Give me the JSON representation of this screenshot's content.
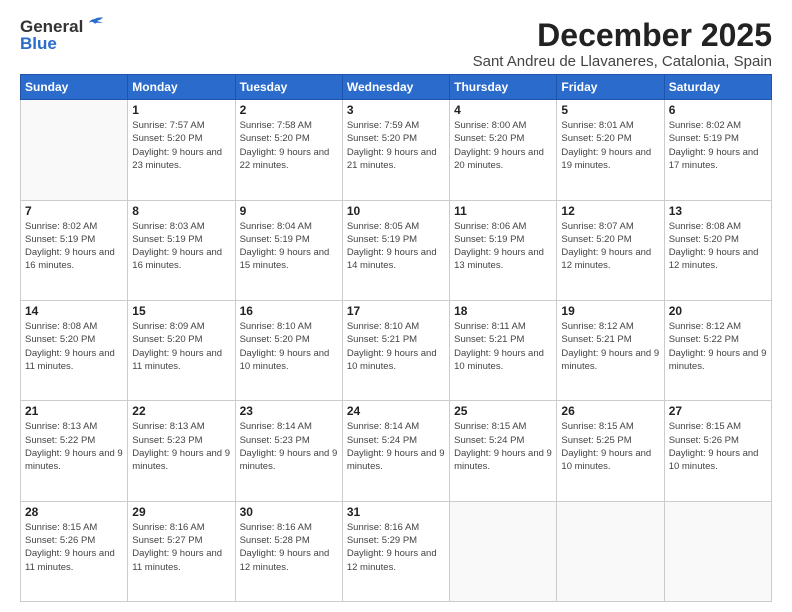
{
  "logo": {
    "general": "General",
    "blue": "Blue"
  },
  "title": "December 2025",
  "location": "Sant Andreu de Llavaneres, Catalonia, Spain",
  "weekdays": [
    "Sunday",
    "Monday",
    "Tuesday",
    "Wednesday",
    "Thursday",
    "Friday",
    "Saturday"
  ],
  "weeks": [
    [
      {
        "date": "",
        "sunrise": "",
        "sunset": "",
        "daylight": ""
      },
      {
        "date": "1",
        "sunrise": "Sunrise: 7:57 AM",
        "sunset": "Sunset: 5:20 PM",
        "daylight": "Daylight: 9 hours and 23 minutes."
      },
      {
        "date": "2",
        "sunrise": "Sunrise: 7:58 AM",
        "sunset": "Sunset: 5:20 PM",
        "daylight": "Daylight: 9 hours and 22 minutes."
      },
      {
        "date": "3",
        "sunrise": "Sunrise: 7:59 AM",
        "sunset": "Sunset: 5:20 PM",
        "daylight": "Daylight: 9 hours and 21 minutes."
      },
      {
        "date": "4",
        "sunrise": "Sunrise: 8:00 AM",
        "sunset": "Sunset: 5:20 PM",
        "daylight": "Daylight: 9 hours and 20 minutes."
      },
      {
        "date": "5",
        "sunrise": "Sunrise: 8:01 AM",
        "sunset": "Sunset: 5:20 PM",
        "daylight": "Daylight: 9 hours and 19 minutes."
      },
      {
        "date": "6",
        "sunrise": "Sunrise: 8:02 AM",
        "sunset": "Sunset: 5:19 PM",
        "daylight": "Daylight: 9 hours and 17 minutes."
      }
    ],
    [
      {
        "date": "7",
        "sunrise": "Sunrise: 8:02 AM",
        "sunset": "Sunset: 5:19 PM",
        "daylight": "Daylight: 9 hours and 16 minutes."
      },
      {
        "date": "8",
        "sunrise": "Sunrise: 8:03 AM",
        "sunset": "Sunset: 5:19 PM",
        "daylight": "Daylight: 9 hours and 16 minutes."
      },
      {
        "date": "9",
        "sunrise": "Sunrise: 8:04 AM",
        "sunset": "Sunset: 5:19 PM",
        "daylight": "Daylight: 9 hours and 15 minutes."
      },
      {
        "date": "10",
        "sunrise": "Sunrise: 8:05 AM",
        "sunset": "Sunset: 5:19 PM",
        "daylight": "Daylight: 9 hours and 14 minutes."
      },
      {
        "date": "11",
        "sunrise": "Sunrise: 8:06 AM",
        "sunset": "Sunset: 5:19 PM",
        "daylight": "Daylight: 9 hours and 13 minutes."
      },
      {
        "date": "12",
        "sunrise": "Sunrise: 8:07 AM",
        "sunset": "Sunset: 5:20 PM",
        "daylight": "Daylight: 9 hours and 12 minutes."
      },
      {
        "date": "13",
        "sunrise": "Sunrise: 8:08 AM",
        "sunset": "Sunset: 5:20 PM",
        "daylight": "Daylight: 9 hours and 12 minutes."
      }
    ],
    [
      {
        "date": "14",
        "sunrise": "Sunrise: 8:08 AM",
        "sunset": "Sunset: 5:20 PM",
        "daylight": "Daylight: 9 hours and 11 minutes."
      },
      {
        "date": "15",
        "sunrise": "Sunrise: 8:09 AM",
        "sunset": "Sunset: 5:20 PM",
        "daylight": "Daylight: 9 hours and 11 minutes."
      },
      {
        "date": "16",
        "sunrise": "Sunrise: 8:10 AM",
        "sunset": "Sunset: 5:20 PM",
        "daylight": "Daylight: 9 hours and 10 minutes."
      },
      {
        "date": "17",
        "sunrise": "Sunrise: 8:10 AM",
        "sunset": "Sunset: 5:21 PM",
        "daylight": "Daylight: 9 hours and 10 minutes."
      },
      {
        "date": "18",
        "sunrise": "Sunrise: 8:11 AM",
        "sunset": "Sunset: 5:21 PM",
        "daylight": "Daylight: 9 hours and 10 minutes."
      },
      {
        "date": "19",
        "sunrise": "Sunrise: 8:12 AM",
        "sunset": "Sunset: 5:21 PM",
        "daylight": "Daylight: 9 hours and 9 minutes."
      },
      {
        "date": "20",
        "sunrise": "Sunrise: 8:12 AM",
        "sunset": "Sunset: 5:22 PM",
        "daylight": "Daylight: 9 hours and 9 minutes."
      }
    ],
    [
      {
        "date": "21",
        "sunrise": "Sunrise: 8:13 AM",
        "sunset": "Sunset: 5:22 PM",
        "daylight": "Daylight: 9 hours and 9 minutes."
      },
      {
        "date": "22",
        "sunrise": "Sunrise: 8:13 AM",
        "sunset": "Sunset: 5:23 PM",
        "daylight": "Daylight: 9 hours and 9 minutes."
      },
      {
        "date": "23",
        "sunrise": "Sunrise: 8:14 AM",
        "sunset": "Sunset: 5:23 PM",
        "daylight": "Daylight: 9 hours and 9 minutes."
      },
      {
        "date": "24",
        "sunrise": "Sunrise: 8:14 AM",
        "sunset": "Sunset: 5:24 PM",
        "daylight": "Daylight: 9 hours and 9 minutes."
      },
      {
        "date": "25",
        "sunrise": "Sunrise: 8:15 AM",
        "sunset": "Sunset: 5:24 PM",
        "daylight": "Daylight: 9 hours and 9 minutes."
      },
      {
        "date": "26",
        "sunrise": "Sunrise: 8:15 AM",
        "sunset": "Sunset: 5:25 PM",
        "daylight": "Daylight: 9 hours and 10 minutes."
      },
      {
        "date": "27",
        "sunrise": "Sunrise: 8:15 AM",
        "sunset": "Sunset: 5:26 PM",
        "daylight": "Daylight: 9 hours and 10 minutes."
      }
    ],
    [
      {
        "date": "28",
        "sunrise": "Sunrise: 8:15 AM",
        "sunset": "Sunset: 5:26 PM",
        "daylight": "Daylight: 9 hours and 11 minutes."
      },
      {
        "date": "29",
        "sunrise": "Sunrise: 8:16 AM",
        "sunset": "Sunset: 5:27 PM",
        "daylight": "Daylight: 9 hours and 11 minutes."
      },
      {
        "date": "30",
        "sunrise": "Sunrise: 8:16 AM",
        "sunset": "Sunset: 5:28 PM",
        "daylight": "Daylight: 9 hours and 12 minutes."
      },
      {
        "date": "31",
        "sunrise": "Sunrise: 8:16 AM",
        "sunset": "Sunset: 5:29 PM",
        "daylight": "Daylight: 9 hours and 12 minutes."
      },
      {
        "date": "",
        "sunrise": "",
        "sunset": "",
        "daylight": ""
      },
      {
        "date": "",
        "sunrise": "",
        "sunset": "",
        "daylight": ""
      },
      {
        "date": "",
        "sunrise": "",
        "sunset": "",
        "daylight": ""
      }
    ]
  ]
}
